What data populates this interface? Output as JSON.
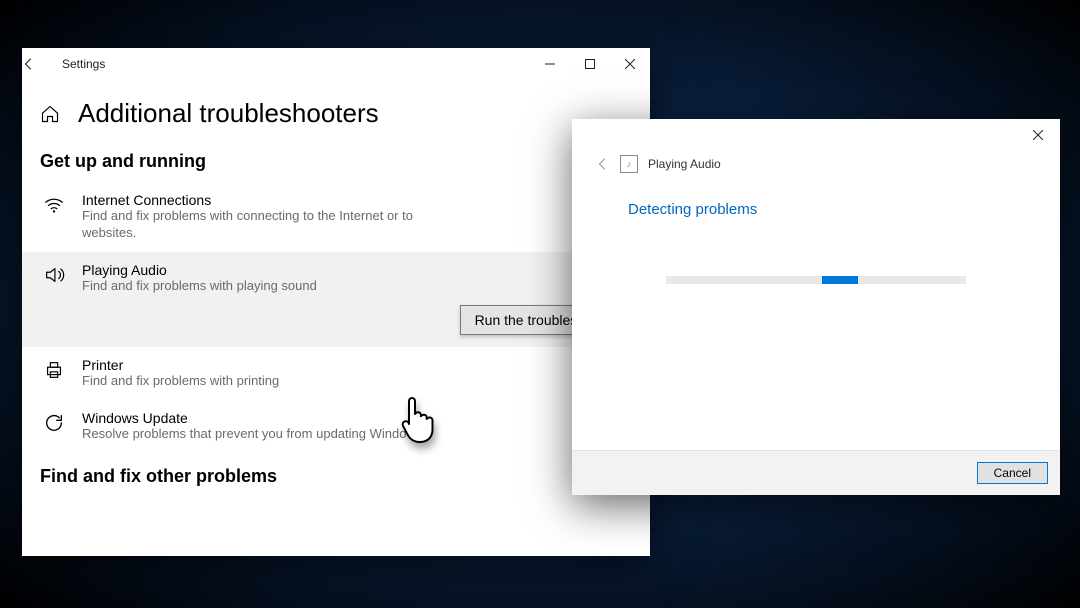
{
  "settings": {
    "window_title": "Settings",
    "page_title": "Additional troubleshooters",
    "section1": "Get up and running",
    "section2": "Find and fix other problems",
    "run_button": "Run the troubleshooter",
    "items": [
      {
        "name": "Internet Connections",
        "desc": "Find and fix problems with connecting to the Internet or to websites."
      },
      {
        "name": "Playing Audio",
        "desc": "Find and fix problems with playing sound"
      },
      {
        "name": "Printer",
        "desc": "Find and fix problems with printing"
      },
      {
        "name": "Windows Update",
        "desc": "Resolve problems that prevent you from updating Windows."
      }
    ]
  },
  "dialog": {
    "title": "Playing Audio",
    "status": "Detecting problems",
    "cancel": "Cancel"
  }
}
